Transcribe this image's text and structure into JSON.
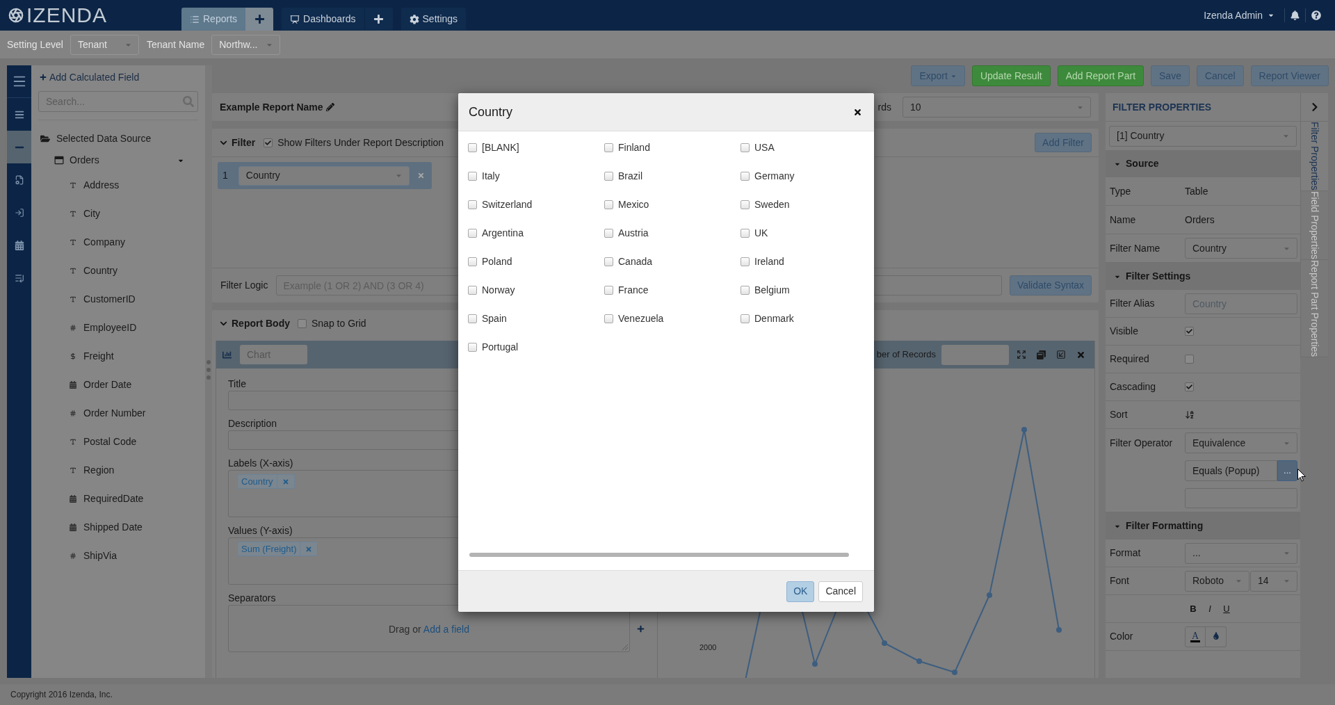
{
  "top_bar": {
    "logo": "IZENDA",
    "tabs": [
      {
        "label": "Reports",
        "selected": true,
        "add_button": true
      },
      {
        "label": "Dashboards",
        "selected": false,
        "add_button": true
      },
      {
        "label": "Settings",
        "selected": false,
        "add_button": false
      }
    ],
    "user": "Izenda Admin"
  },
  "settings_bar": [
    {
      "label": "Setting Level",
      "value": "Tenant",
      "disabled": true
    },
    {
      "label": "Tenant Name",
      "value": "Northw...",
      "disabled": true
    }
  ],
  "side_nav": [
    {
      "selected": false
    },
    {
      "selected": false
    },
    {
      "selected": true
    },
    {
      "selected": false
    },
    {
      "selected": false
    },
    {
      "selected": false
    },
    {
      "selected": false
    }
  ],
  "data_panel": {
    "add_button": "Add Calculated Field",
    "search": {
      "placeholder": "Search..."
    },
    "tree": [
      {
        "label": "Selected Data Source",
        "children": [
          {
            "label": "Orders",
            "children": [
              {
                "label": "Address",
                "kind": "text"
              },
              {
                "label": "City",
                "kind": "text"
              },
              {
                "label": "Company",
                "kind": "text"
              },
              {
                "label": "Country",
                "kind": "text"
              },
              {
                "label": "CustomerID",
                "kind": "text"
              },
              {
                "label": "EmployeeID",
                "kind": "number"
              },
              {
                "label": "Freight",
                "kind": "money"
              },
              {
                "label": "Order Date",
                "kind": "date"
              },
              {
                "label": "Order Number",
                "kind": "number"
              },
              {
                "label": "Postal Code",
                "kind": "text"
              },
              {
                "label": "Region",
                "kind": "text"
              },
              {
                "label": "RequiredDate",
                "kind": "date"
              },
              {
                "label": "Shipped Date",
                "kind": "date"
              },
              {
                "label": "ShipVia",
                "kind": "number"
              }
            ]
          }
        ]
      }
    ]
  },
  "toolbar": [
    {
      "label": "Export",
      "kind": "menu"
    },
    {
      "label": "Update Result",
      "kind": "primary"
    },
    {
      "label": "Add Report Part",
      "kind": "primary"
    },
    {
      "label": "Save",
      "kind": "default"
    },
    {
      "label": "Cancel",
      "kind": "default"
    },
    {
      "label": "Report Viewer",
      "kind": "default"
    }
  ],
  "report": {
    "name": "Example Report Name",
    "records": {
      "label": "rds",
      "value": "10"
    },
    "filter": {
      "title": "Filter",
      "expanded": true,
      "show_under_description": {
        "label": "Show Filters Under Report Description",
        "checked": true
      },
      "add_button": "Add Filter",
      "filters": [
        {
          "number": "1",
          "field": "Country"
        }
      ],
      "logic": {
        "label": "Filter Logic",
        "placeholder": "Example (1 OR 2) AND (3 OR 4)"
      },
      "validate_button": "Validate Syntax"
    },
    "body": {
      "title": "Report Body",
      "expanded": true,
      "snap_to_grid": {
        "label": "Snap to Grid",
        "checked": false
      },
      "part": {
        "name": "Chart",
        "records_label": "ber of Records",
        "fields": [
          {
            "label": "Title",
            "kind": "input"
          },
          {
            "label": "Description",
            "kind": "input"
          },
          {
            "label": "Labels (X-axis)",
            "kind": "dropzone",
            "chips": [
              "Country"
            ]
          },
          {
            "label": "Values (Y-axis)",
            "kind": "dropzone",
            "chips": [
              "Sum (Freight)"
            ]
          },
          {
            "label": "Separators",
            "kind": "dropzone",
            "hint": "Drag or",
            "link": "Add a field",
            "addable": true
          }
        ],
        "chart": {
          "axis_label": "2000"
        }
      }
    }
  },
  "modal": {
    "title": "Country",
    "options": [
      {
        "label": "[BLANK]",
        "checked": false
      },
      {
        "label": "Finland",
        "checked": false
      },
      {
        "label": "USA",
        "checked": false
      },
      {
        "label": "Italy",
        "checked": false
      },
      {
        "label": "Brazil",
        "checked": false
      },
      {
        "label": "Germany",
        "checked": false
      },
      {
        "label": "Switzerland",
        "checked": false
      },
      {
        "label": "Mexico",
        "checked": false
      },
      {
        "label": "Sweden",
        "checked": false
      },
      {
        "label": "Argentina",
        "checked": false
      },
      {
        "label": "Austria",
        "checked": false
      },
      {
        "label": "UK",
        "checked": false
      },
      {
        "label": "Poland",
        "checked": false
      },
      {
        "label": "Canada",
        "checked": false
      },
      {
        "label": "Ireland",
        "checked": false
      },
      {
        "label": "Norway",
        "checked": false
      },
      {
        "label": "France",
        "checked": false
      },
      {
        "label": "Belgium",
        "checked": false
      },
      {
        "label": "Spain",
        "checked": false
      },
      {
        "label": "Venezuela",
        "checked": false
      },
      {
        "label": "Denmark",
        "checked": false
      },
      {
        "label": "Portugal",
        "checked": false
      }
    ],
    "buttons": [
      {
        "label": "OK",
        "kind": "primary"
      },
      {
        "label": "Cancel",
        "kind": "default"
      }
    ]
  },
  "properties": {
    "title": "FILTER PROPERTIES",
    "selector": "[1] Country",
    "sections": [
      {
        "title": "Source",
        "expanded": true,
        "rows": [
          {
            "label": "Type",
            "kind": "text",
            "value": "Table"
          },
          {
            "label": "Name",
            "kind": "text",
            "value": "Orders"
          },
          {
            "label": "Filter Name",
            "kind": "select",
            "value": "Country"
          }
        ]
      },
      {
        "title": "Filter Settings",
        "expanded": true,
        "rows": [
          {
            "label": "Filter Alias",
            "kind": "input",
            "placeholder": "Country"
          },
          {
            "label": "Visible",
            "kind": "checkbox",
            "checked": true
          },
          {
            "label": "Required",
            "kind": "checkbox",
            "checked": false
          },
          {
            "label": "Cascading",
            "kind": "checkbox",
            "checked": true
          },
          {
            "label": "Sort",
            "kind": "sort"
          },
          {
            "label": "Filter Operator",
            "kind": "operator",
            "value": "Equivalence",
            "operand": "Equals (Popup)",
            "button": "..."
          }
        ]
      },
      {
        "title": "Filter Formatting",
        "expanded": true,
        "rows": [
          {
            "label": "Format",
            "kind": "select",
            "value": "..."
          },
          {
            "label": "Font",
            "kind": "font",
            "family": "Roboto",
            "size": "14"
          },
          {
            "kind": "styles",
            "buttons": [
              "B",
              "I",
              "U"
            ]
          },
          {
            "label": "Color",
            "kind": "color",
            "glyph": "A"
          }
        ]
      }
    ]
  },
  "side_tabs": [
    {
      "label": "Filter Properties",
      "selected": true
    },
    {
      "label": "Field Properties",
      "selected": false
    },
    {
      "label": "Report Part Properties",
      "selected": false
    }
  ],
  "footer": "Copyright 2016 Izenda, Inc."
}
